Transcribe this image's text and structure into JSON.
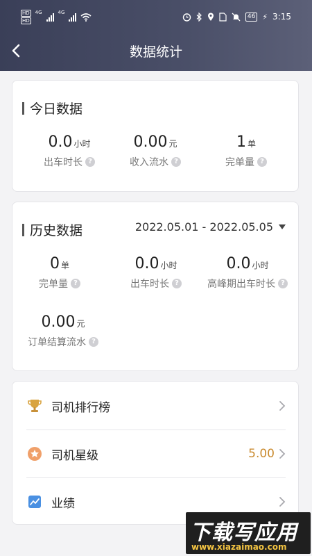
{
  "status": {
    "hd1": "HD",
    "hd2": "HD",
    "net1": "4G",
    "net2": "4G",
    "battery": "46",
    "time": "3:15"
  },
  "nav": {
    "title": "数据统计"
  },
  "today": {
    "title": "今日数据",
    "stats": [
      {
        "value": "0.0",
        "unit": "小时",
        "label": "出车时长"
      },
      {
        "value": "0.00",
        "unit": "元",
        "label": "收入流水"
      },
      {
        "value": "1",
        "unit": "单",
        "label": "完单量"
      }
    ]
  },
  "history": {
    "title": "历史数据",
    "range": "2022.05.01 - 2022.05.05",
    "stats": [
      {
        "value": "0",
        "unit": "单",
        "label": "完单量"
      },
      {
        "value": "0.0",
        "unit": "小时",
        "label": "出车时长"
      },
      {
        "value": "0.0",
        "unit": "小时",
        "label": "高峰期出车时长"
      },
      {
        "value": "0.00",
        "unit": "元",
        "label": "订单结算流水"
      }
    ]
  },
  "menu": [
    {
      "label": "司机排行榜",
      "value": "",
      "icon": "trophy-icon"
    },
    {
      "label": "司机星级",
      "value": "5.00",
      "icon": "star-badge-icon"
    },
    {
      "label": "业绩",
      "value": "",
      "icon": "chart-icon"
    }
  ],
  "watermark": {
    "title": "下载写应用",
    "url": "www.xiazaimao.com"
  },
  "colors": {
    "header": "#3f4460",
    "accent": "#c98a2e"
  }
}
